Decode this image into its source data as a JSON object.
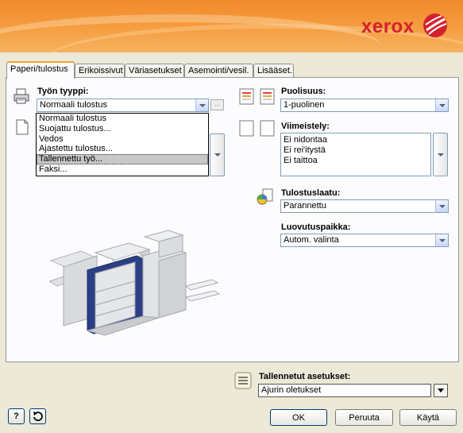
{
  "brand": {
    "logo_text": "xerox",
    "color": "#d4212c"
  },
  "tabs": [
    {
      "label": "Paperi/tulostus",
      "active": true
    },
    {
      "label": "Erikoissivut"
    },
    {
      "label": "Väriasetukset"
    },
    {
      "label": "Asemointi/vesil."
    },
    {
      "label": "Lisääset."
    }
  ],
  "job_type": {
    "label": "Työn tyyppi:",
    "value": "Normaali tulostus",
    "options": [
      "Normaali tulostus",
      "Suojattu tulostus...",
      "Vedos",
      "Ajastettu tulostus...",
      "Tallennettu työ...",
      "Faksi..."
    ],
    "highlighted_index": 4,
    "more_button": "..."
  },
  "duplex": {
    "label": "Puolisuus:",
    "value": "1-puolinen"
  },
  "finishing": {
    "label": "Viimeistely:",
    "items": [
      "Ei nidontaa",
      "Ei rei'itystä",
      "Ei taittoa"
    ]
  },
  "quality": {
    "label": "Tulostuslaatu:",
    "value": "Parannettu"
  },
  "output": {
    "label": "Luovutuspaikka:",
    "value": "Autom. valinta"
  },
  "saved_settings": {
    "label": "Tallennetut asetukset:",
    "value": "Ajurin oletukset"
  },
  "buttons": {
    "help": "?",
    "ok": "OK",
    "cancel": "Peruuta",
    "apply": "Käytä"
  },
  "icons": {
    "printer": "printer-icon",
    "paper": "paper-icon",
    "duplex": "duplex-pages-icon",
    "finishing": "finishing-pages-icon",
    "quality": "print-quality-icon",
    "saved": "saved-settings-icon",
    "restore": "restore-icon"
  }
}
